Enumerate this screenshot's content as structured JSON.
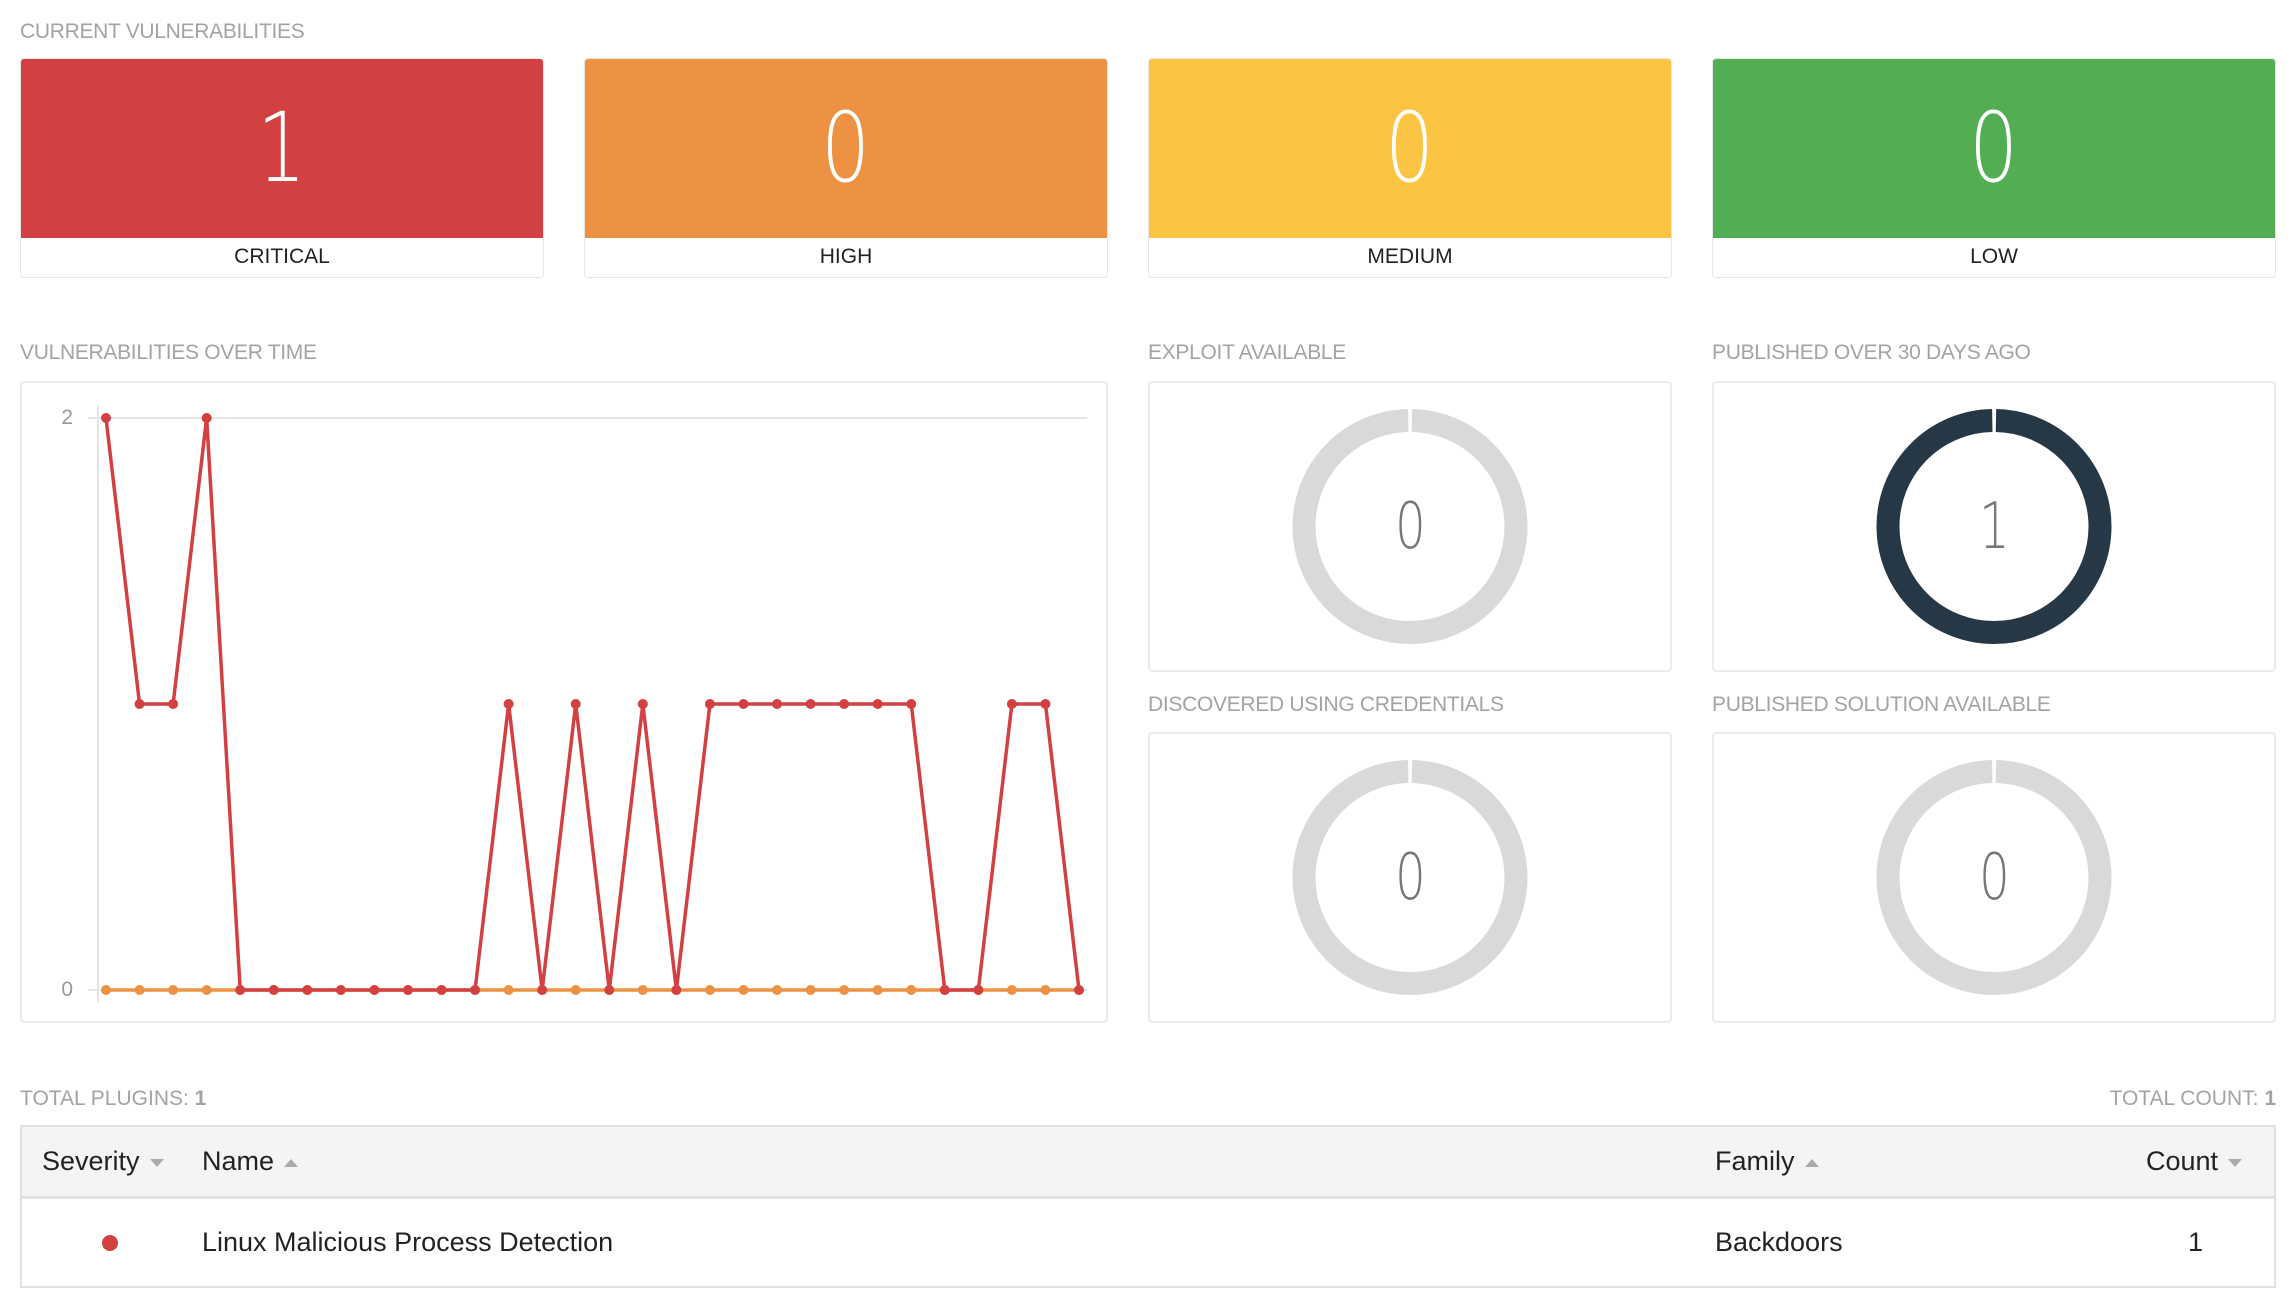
{
  "current_vulnerabilities": {
    "title": "CURRENT VULNERABILITIES",
    "cards": [
      {
        "label": "CRITICAL",
        "count": "1",
        "color": "#d24041"
      },
      {
        "label": "HIGH",
        "count": "0",
        "color": "#ec9242"
      },
      {
        "label": "MEDIUM",
        "count": "0",
        "color": "#fcc443"
      },
      {
        "label": "LOW",
        "count": "0",
        "color": "#52ad53"
      }
    ]
  },
  "chart_data": {
    "type": "line",
    "title": "VULNERABILITIES OVER TIME",
    "xlabel": "",
    "ylabel": "",
    "ylim": [
      0,
      2
    ],
    "yticks": [
      "0",
      "2"
    ],
    "grid": true,
    "x": [
      1,
      2,
      3,
      4,
      5,
      6,
      7,
      8,
      9,
      10,
      11,
      12,
      13,
      14,
      15,
      16,
      17,
      18,
      19,
      20,
      21,
      22,
      23,
      24,
      25,
      26,
      27,
      28,
      29,
      30
    ],
    "series": [
      {
        "name": "Critical",
        "color": "#d24041",
        "values": [
          2,
          1,
          1,
          2,
          0,
          0,
          0,
          0,
          0,
          0,
          0,
          0,
          1,
          0,
          1,
          0,
          1,
          0,
          1,
          1,
          1,
          1,
          1,
          1,
          1,
          0,
          0,
          1,
          1,
          0
        ]
      },
      {
        "name": "High",
        "color": "#ec9242",
        "values": [
          0,
          0,
          0,
          0,
          0,
          0,
          0,
          0,
          0,
          0,
          0,
          0,
          0,
          0,
          0,
          0,
          0,
          0,
          0,
          0,
          0,
          0,
          0,
          0,
          0,
          0,
          0,
          0,
          0,
          0
        ]
      }
    ]
  },
  "donuts": [
    {
      "title": "EXPLOIT AVAILABLE",
      "value": "0",
      "fraction": 0,
      "color": "#263746",
      "track": "#d9d9d9"
    },
    {
      "title": "PUBLISHED OVER 30 DAYS AGO",
      "value": "1",
      "fraction": 1,
      "color": "#263746",
      "track": "#d9d9d9"
    },
    {
      "title": "DISCOVERED USING CREDENTIALS",
      "value": "0",
      "fraction": 0,
      "color": "#263746",
      "track": "#d9d9d9"
    },
    {
      "title": "PUBLISHED SOLUTION AVAILABLE",
      "value": "0",
      "fraction": 0,
      "color": "#263746",
      "track": "#d9d9d9"
    }
  ],
  "plugins": {
    "total_plugins_label": "TOTAL PLUGINS:",
    "total_plugins": "1",
    "total_count_label": "TOTAL COUNT:",
    "total_count": "1",
    "columns": [
      {
        "label": "Severity",
        "sort": "down"
      },
      {
        "label": "Name",
        "sort": "up"
      },
      {
        "label": "Family",
        "sort": "up"
      },
      {
        "label": "Count",
        "sort": "down"
      }
    ],
    "rows": [
      {
        "severity": "critical",
        "severity_color": "#d24040",
        "name": "Linux Malicious Process Detection",
        "family": "Backdoors",
        "count": "1"
      }
    ]
  }
}
